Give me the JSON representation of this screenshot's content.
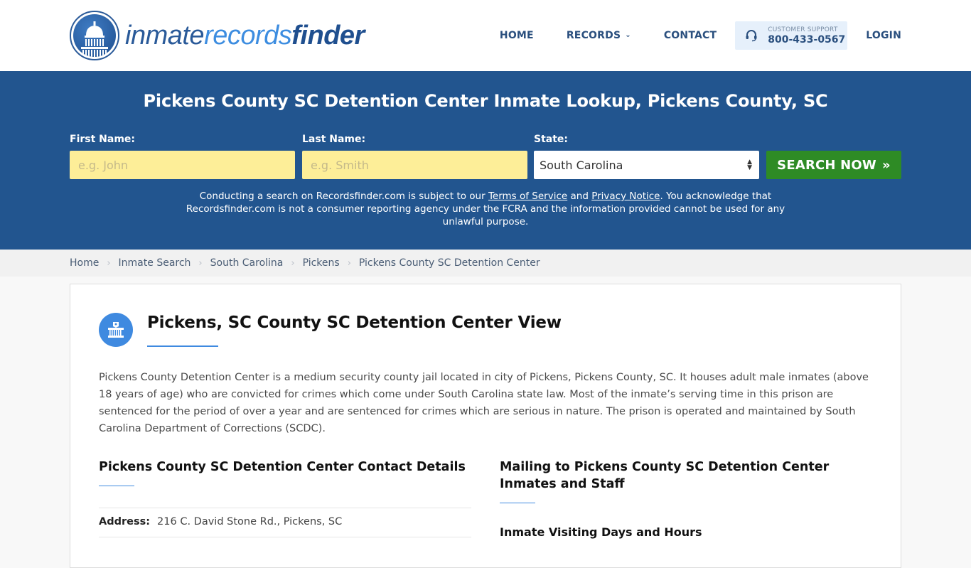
{
  "brand": {
    "logo_part1": "inmate",
    "logo_part2": "records",
    "logo_part3": "finder",
    "logo_icon": "capitol-dome-icon"
  },
  "nav": {
    "home": "HOME",
    "records": "RECORDS",
    "contact": "CONTACT",
    "support_label": "CUSTOMER SUPPORT",
    "support_phone": "800-433-0567",
    "login": "LOGIN"
  },
  "hero": {
    "title": "Pickens County SC Detention Center Inmate Lookup, Pickens County, SC",
    "first_name_label": "First Name:",
    "first_name_placeholder": "e.g. John",
    "first_name_value": "",
    "last_name_label": "Last Name:",
    "last_name_placeholder": "e.g. Smith",
    "last_name_value": "",
    "state_label": "State:",
    "state_value": "South Carolina",
    "search_button": "SEARCH NOW",
    "disclaimer_1": "Conducting a search on Recordsfinder.com is subject to our ",
    "terms_link": "Terms of Service",
    "disclaimer_and": " and ",
    "privacy_link": "Privacy Notice",
    "disclaimer_2": ". You acknowledge that Recordsfinder.com is not a consumer reporting agency under the FCRA and the information provided cannot be used for any unlawful purpose."
  },
  "breadcrumb": [
    "Home",
    "Inmate Search",
    "South Carolina",
    "Pickens",
    "Pickens County SC Detention Center"
  ],
  "main": {
    "title": "Pickens, SC County SC Detention Center View",
    "description": "Pickens County Detention Center is a medium security county jail located in city of Pickens, Pickens County, SC. It houses adult male inmates (above 18 years of age) who are convicted for crimes which come under South Carolina state law. Most of the inmate’s serving time in this prison are sentenced for the period of over a year and are sentenced for crimes which are serious in nature. The prison is operated and maintained by South Carolina Department of Corrections (SCDC).",
    "contact_title": "Pickens County SC Detention Center Contact Details",
    "address_label": "Address:",
    "address_value": "216 C. David Stone Rd., Pickens, SC",
    "mailing_title": "Mailing to Pickens County SC Detention Center Inmates and Staff",
    "visiting_title": "Inmate Visiting Days and Hours"
  },
  "colors": {
    "hero_bg": "#22558f",
    "search_button": "#2e8b25",
    "input_bg": "#fdee98",
    "accent": "#3f8ae0",
    "nav_text": "#2a4f7e"
  }
}
